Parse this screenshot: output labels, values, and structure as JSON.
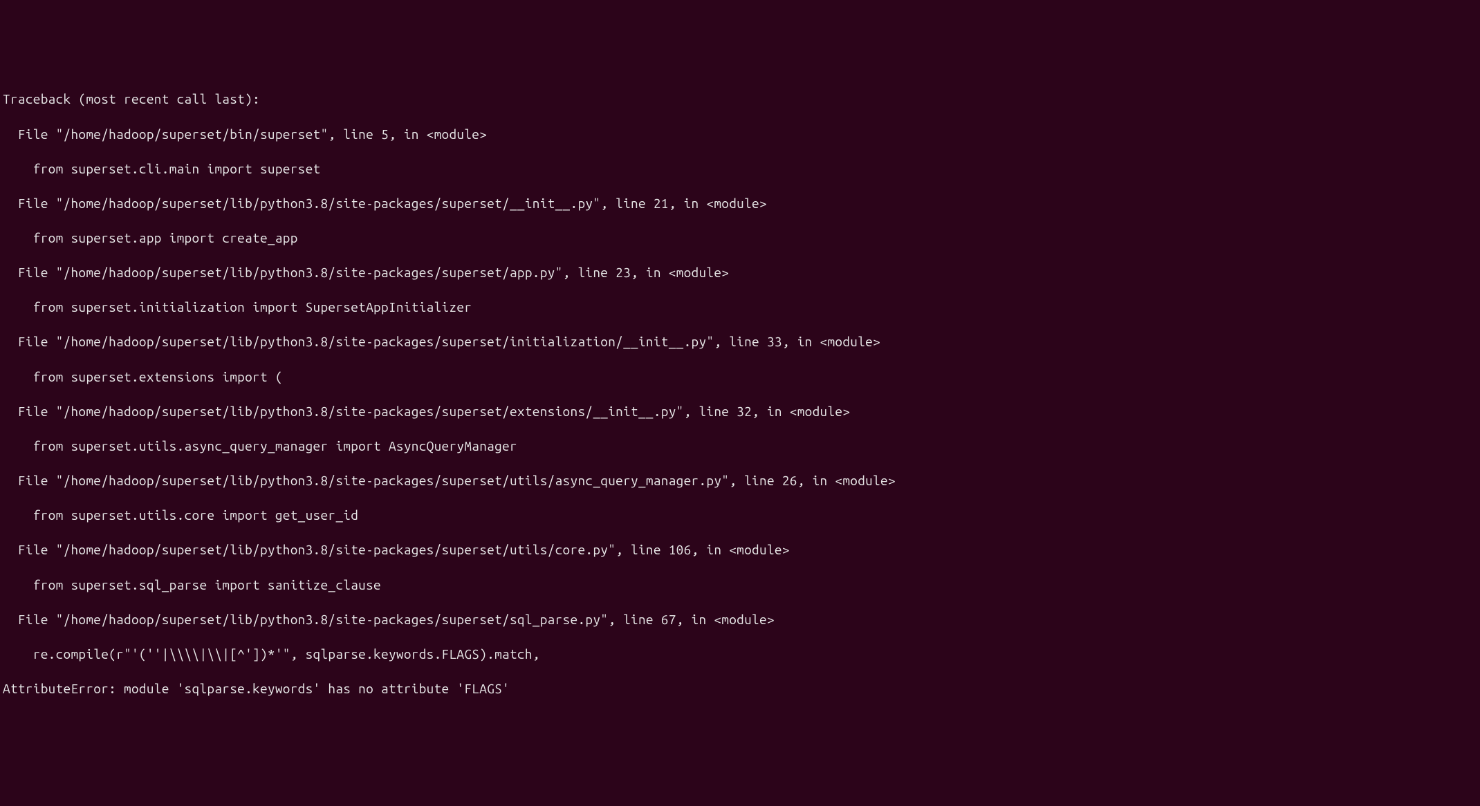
{
  "traceback": {
    "header": "Traceback (most recent call last):",
    "frames": [
      {
        "file_line": "  File \"/home/hadoop/superset/bin/superset\", line 5, in <module>",
        "code_line": "    from superset.cli.main import superset"
      },
      {
        "file_line": "  File \"/home/hadoop/superset/lib/python3.8/site-packages/superset/__init__.py\", line 21, in <module>",
        "code_line": "    from superset.app import create_app"
      },
      {
        "file_line": "  File \"/home/hadoop/superset/lib/python3.8/site-packages/superset/app.py\", line 23, in <module>",
        "code_line": "    from superset.initialization import SupersetAppInitializer"
      },
      {
        "file_line": "  File \"/home/hadoop/superset/lib/python3.8/site-packages/superset/initialization/__init__.py\", line 33, in <module>",
        "code_line": "    from superset.extensions import ("
      },
      {
        "file_line": "  File \"/home/hadoop/superset/lib/python3.8/site-packages/superset/extensions/__init__.py\", line 32, in <module>",
        "code_line": "    from superset.utils.async_query_manager import AsyncQueryManager"
      },
      {
        "file_line": "  File \"/home/hadoop/superset/lib/python3.8/site-packages/superset/utils/async_query_manager.py\", line 26, in <module>",
        "code_line": "    from superset.utils.core import get_user_id"
      },
      {
        "file_line": "  File \"/home/hadoop/superset/lib/python3.8/site-packages/superset/utils/core.py\", line 106, in <module>",
        "code_line": "    from superset.sql_parse import sanitize_clause"
      },
      {
        "file_line": "  File \"/home/hadoop/superset/lib/python3.8/site-packages/superset/sql_parse.py\", line 67, in <module>",
        "code_line": "    re.compile(r\"'(''|\\\\\\\\|\\\\|[^'])*'\", sqlparse.keywords.FLAGS).match,"
      }
    ],
    "error": "AttributeError: module 'sqlparse.keywords' has no attribute 'FLAGS'"
  }
}
